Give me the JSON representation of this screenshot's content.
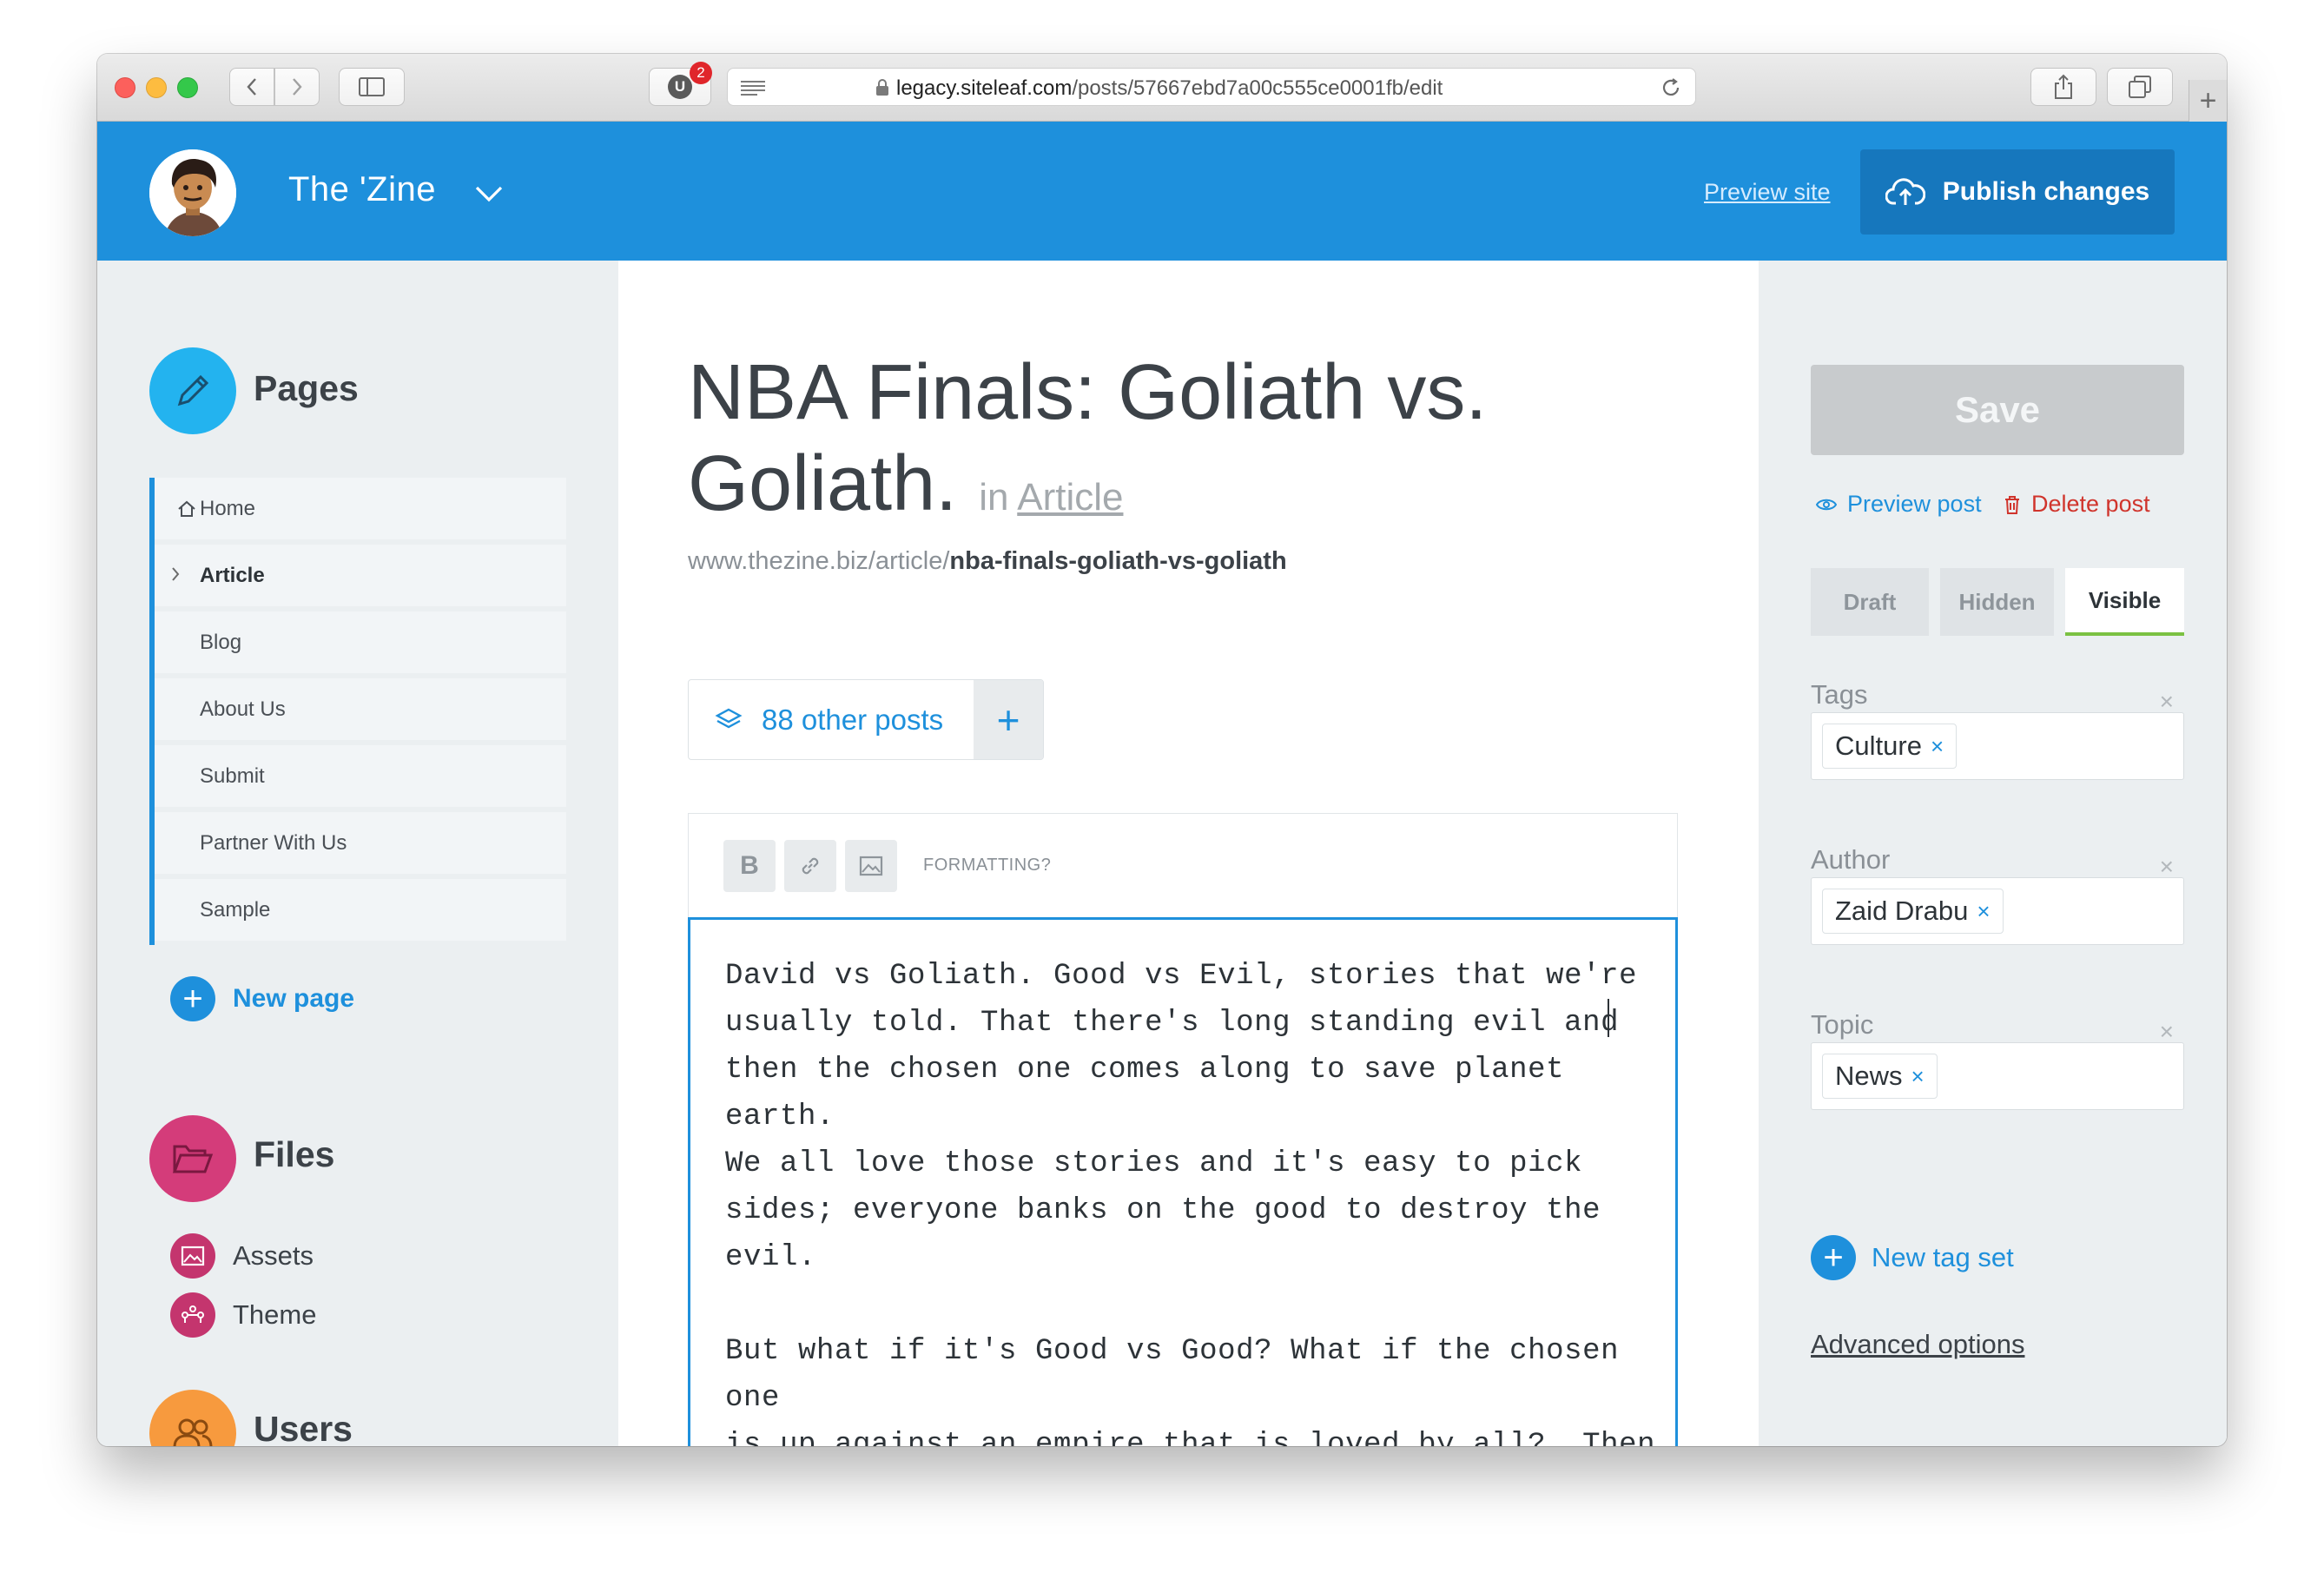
{
  "browser": {
    "url_host": "legacy.siteleaf.com",
    "url_path": "/posts/57667ebd7a00c555ce0001fb/edit",
    "extension_badge": "2"
  },
  "topbar": {
    "site_title": "The 'Zine",
    "preview_site": "Preview site",
    "publish_label": "Publish changes"
  },
  "sidebar": {
    "pages_title": "Pages",
    "nav": [
      {
        "label": "Home"
      },
      {
        "label": "Article"
      },
      {
        "label": "Blog"
      },
      {
        "label": "About Us"
      },
      {
        "label": "Submit"
      },
      {
        "label": "Partner With Us"
      },
      {
        "label": "Sample"
      }
    ],
    "new_page": "New page",
    "files_title": "Files",
    "files": [
      {
        "label": "Assets"
      },
      {
        "label": "Theme"
      }
    ],
    "users_title": "Users"
  },
  "post": {
    "title": "NBA Finals: Goliath vs. Goliath.",
    "in_label": "in",
    "category": "Article",
    "permalink_base": "www.thezine.biz/article/",
    "slug": "nba-finals-goliath-vs-goliath",
    "other_posts": "88 other posts",
    "formatting_label": "FORMATTING?",
    "body": "David vs Goliath. Good vs Evil, stories that we're\nusually told. That there's long standing evil and\nthen the chosen one comes along to save planet earth.\nWe all love those stories and it's easy to pick\nsides; everyone banks on the good to destroy the\nevil.\n\nBut what if it's Good vs Good? What if the chosen one\nis up against an empire that is loved by all?  Then\nit gets really hard to pick sides, and you can just\nsit and witness the greatest show of all time."
  },
  "right": {
    "save": "Save",
    "preview_post": "Preview post",
    "delete_post": "Delete post",
    "visibility": [
      {
        "label": "Draft"
      },
      {
        "label": "Hidden"
      },
      {
        "label": "Visible"
      }
    ],
    "visibility_selected": "Visible",
    "tag_sets": [
      {
        "label": "Tags",
        "value": "Culture"
      },
      {
        "label": "Author",
        "value": "Zaid Drabu"
      },
      {
        "label": "Topic",
        "value": "News"
      }
    ],
    "new_tag_set": "New tag set",
    "advanced_options": "Advanced options"
  },
  "colors": {
    "accent": "#1e90dc",
    "publish_button": "#1677bd",
    "delete": "#d0342c",
    "files": "#c4356e",
    "users": "#f79a3e",
    "pages": "#23b3ef"
  },
  "icons": {
    "pages": "pencil-icon",
    "files": "folder-icon",
    "users": "users-icon",
    "publish": "cloud-upload-icon",
    "other_posts": "layers-icon"
  }
}
